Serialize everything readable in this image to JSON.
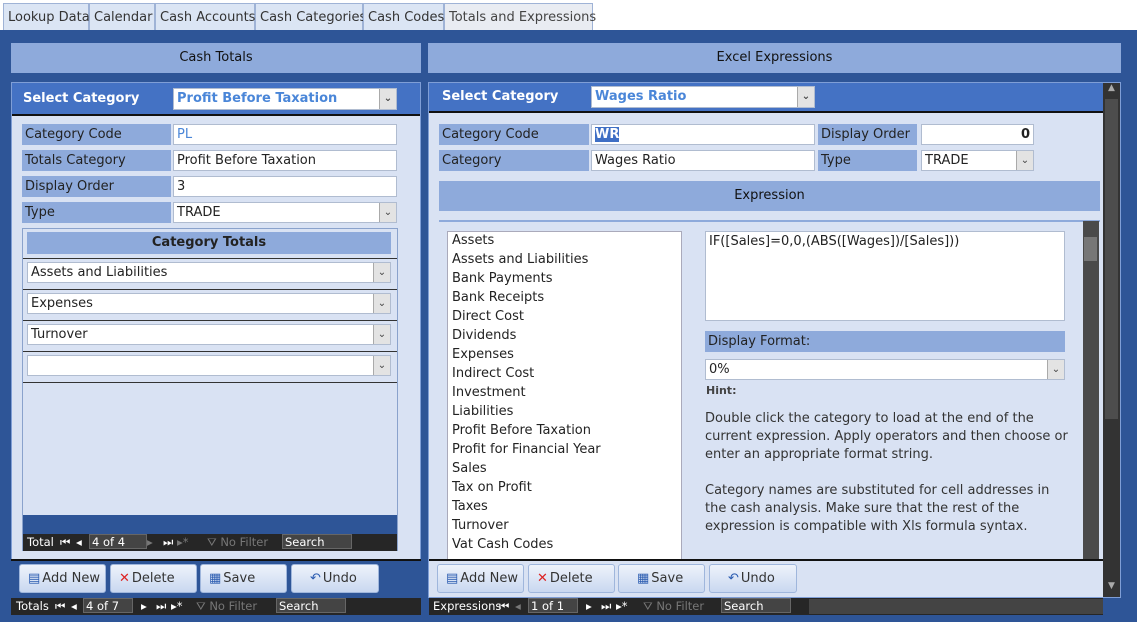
{
  "tabs": [
    "Lookup Data",
    "Calendar",
    "Cash Accounts",
    "Cash Categories",
    "Cash Codes",
    "Totals and Expressions"
  ],
  "selected_tab": "Totals and Expressions",
  "left": {
    "title": "Cash Totals",
    "select_label": "Select Category",
    "select_value": "Profit Before Taxation",
    "fields": {
      "category_code_label": "Category Code",
      "category_code": "PL",
      "totals_category_label": "Totals Category",
      "totals_category": "Profit Before Taxation",
      "display_order_label": "Display Order",
      "display_order": "3",
      "type_label": "Type",
      "type": "TRADE"
    },
    "subform": {
      "title": "Category Totals",
      "rows": [
        "Assets and Liabilities",
        "Expenses",
        "Turnover",
        ""
      ],
      "nav": {
        "label": "Total",
        "record": "4 of 4",
        "filter": "No Filter",
        "search": "Search"
      }
    },
    "nav": {
      "label": "Totals",
      "record": "4 of 7",
      "filter": "No Filter",
      "search": "Search"
    }
  },
  "right": {
    "title": "Excel Expressions",
    "select_label": "Select Category",
    "select_value": "Wages Ratio",
    "fields": {
      "category_code_label": "Category Code",
      "category_code": "WR",
      "category_label": "Category",
      "category": "Wages Ratio",
      "display_order_label": "Display Order",
      "display_order": "0",
      "type_label": "Type",
      "type": "TRADE"
    },
    "expression_title": "Expression",
    "categories": [
      "Assets",
      "Assets and Liabilities",
      "Bank Payments",
      "Bank Receipts",
      "Direct Cost",
      "Dividends",
      "Expenses",
      "Indirect Cost",
      "Investment",
      "Liabilities",
      "Profit Before Taxation",
      "Profit for Financial Year",
      "Sales",
      "Tax on Profit",
      "Taxes",
      "Turnover",
      "Vat Cash Codes"
    ],
    "expression": "IF([Sales]=0,0,(ABS([Wages])/[Sales]))",
    "display_format_label": "Display Format:",
    "display_format": "0%",
    "hint_label": "Hint:",
    "hint_1": "Double click the category to load at the end of the current expression.  Apply operators and then choose or enter an appropriate format string.",
    "hint_2": "Category names are substituted for cell addresses in the cash analysis.  Make sure that the rest of the expression is compatible with Xls formula syntax.",
    "nav": {
      "label": "Expressions",
      "record": "1 of 1",
      "filter": "No Filter",
      "search": "Search"
    }
  },
  "buttons": {
    "add_new": "Add New",
    "delete": "Delete",
    "save": "Save",
    "undo": "Undo"
  },
  "colors": {
    "background": "#2e5597",
    "header": "#8eaadb",
    "select_row": "#4472c4",
    "content": "#d9e2f3",
    "select_text": "#4a86d8"
  }
}
